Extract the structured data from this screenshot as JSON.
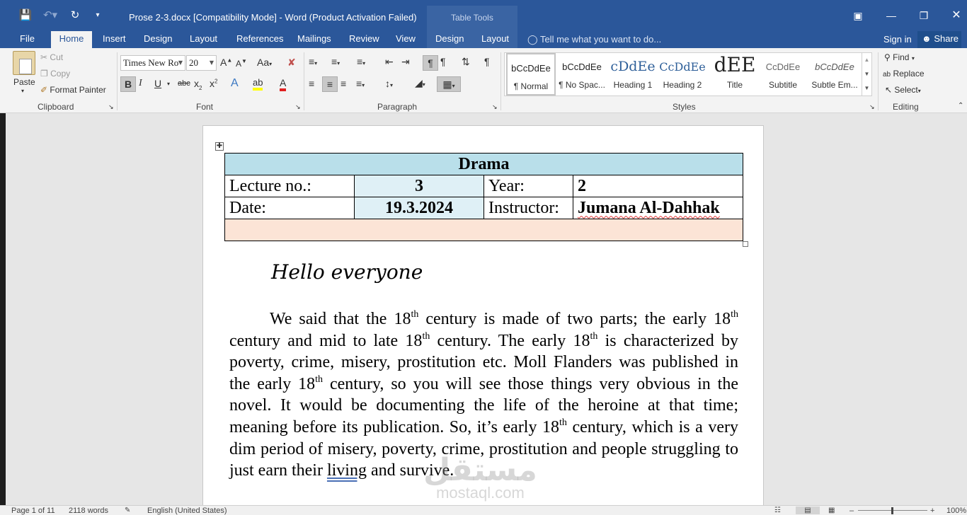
{
  "titlebar": {
    "doc_title": "Prose 2-3.docx [Compatibility Mode] - Word (Product Activation Failed)",
    "contextual_title": "Table Tools",
    "qat": {
      "save_icon": "save-icon",
      "undo_icon": "undo-icon",
      "redo_icon": "redo-icon",
      "customize_icon": "customize-qat-icon"
    },
    "window_buttons": [
      "ribbon-display-options-icon",
      "minimize-icon",
      "restore-icon",
      "close-icon"
    ]
  },
  "tabs": {
    "file": "File",
    "home": "Home",
    "insert": "Insert",
    "design": "Design",
    "layout": "Layout",
    "references": "References",
    "mailings": "Mailings",
    "review": "Review",
    "view": "View",
    "table_design": "Design",
    "table_layout": "Layout",
    "tell_me": "Tell me what you want to do...",
    "sign_in": "Sign in",
    "share": "Share"
  },
  "clipboard": {
    "paste": "Paste",
    "cut": "Cut",
    "copy": "Copy",
    "format_painter": "Format Painter",
    "label": "Clipboard"
  },
  "font": {
    "name": "Times New Ro",
    "size": "20",
    "label": "Font"
  },
  "paragraph": {
    "label": "Paragraph"
  },
  "styles": {
    "label": "Styles",
    "items": [
      {
        "sample": "bCcDdEe",
        "name": "¶ Normal"
      },
      {
        "sample": "bCcDdEe",
        "name": "¶ No Spac..."
      },
      {
        "sample": "cDdEe",
        "name": "Heading 1"
      },
      {
        "sample": "CcDdEe",
        "name": "Heading 2"
      },
      {
        "sample": "dEE",
        "name": "Title"
      },
      {
        "sample": "CcDdEe",
        "name": "Subtitle"
      },
      {
        "sample": "bCcDdEe",
        "name": "Subtle Em..."
      }
    ]
  },
  "editing": {
    "find": "Find",
    "replace": "Replace",
    "select": "Select",
    "label": "Editing"
  },
  "document": {
    "table": {
      "title": "Drama",
      "lecture_label": "Lecture no.:",
      "lecture_value": "3",
      "year_label": "Year:",
      "year_value": "2",
      "date_label": "Date:",
      "date_value": "19.3.2024",
      "instructor_label": "Instructor:",
      "instructor_value": "Jumana Al-Dahhak"
    },
    "greeting": "Hello everyone",
    "body": {
      "t1": "We said that the 18",
      "s1": "th",
      "t2": " century is made of two parts; the early 18",
      "s2": "th",
      "t3": " century and mid to late 18",
      "s3": "th",
      "t4": " century. The early 18",
      "s4": "th",
      "t5": " is characterized by poverty, crime, misery, prostitution etc.  Moll Flanders was published in the early 18",
      "s5": "th",
      "t6": " century, so you will see those things very obvious in the novel. It would be documenting the life of the heroine at that time; meaning before its publication. So, it’s early 18",
      "s6": "th",
      "t7": " century, which is a very dim period of misery, poverty, crime, prostitution and people struggling to just earn their ",
      "t8": "living",
      "t9": " and survive."
    },
    "watermark": {
      "line1": "مستقل",
      "line2": "mostaql.com"
    }
  },
  "status": {
    "page": "Page 1 of 11",
    "words": "2118 words",
    "language": "English (United States)",
    "zoom": "100%"
  }
}
